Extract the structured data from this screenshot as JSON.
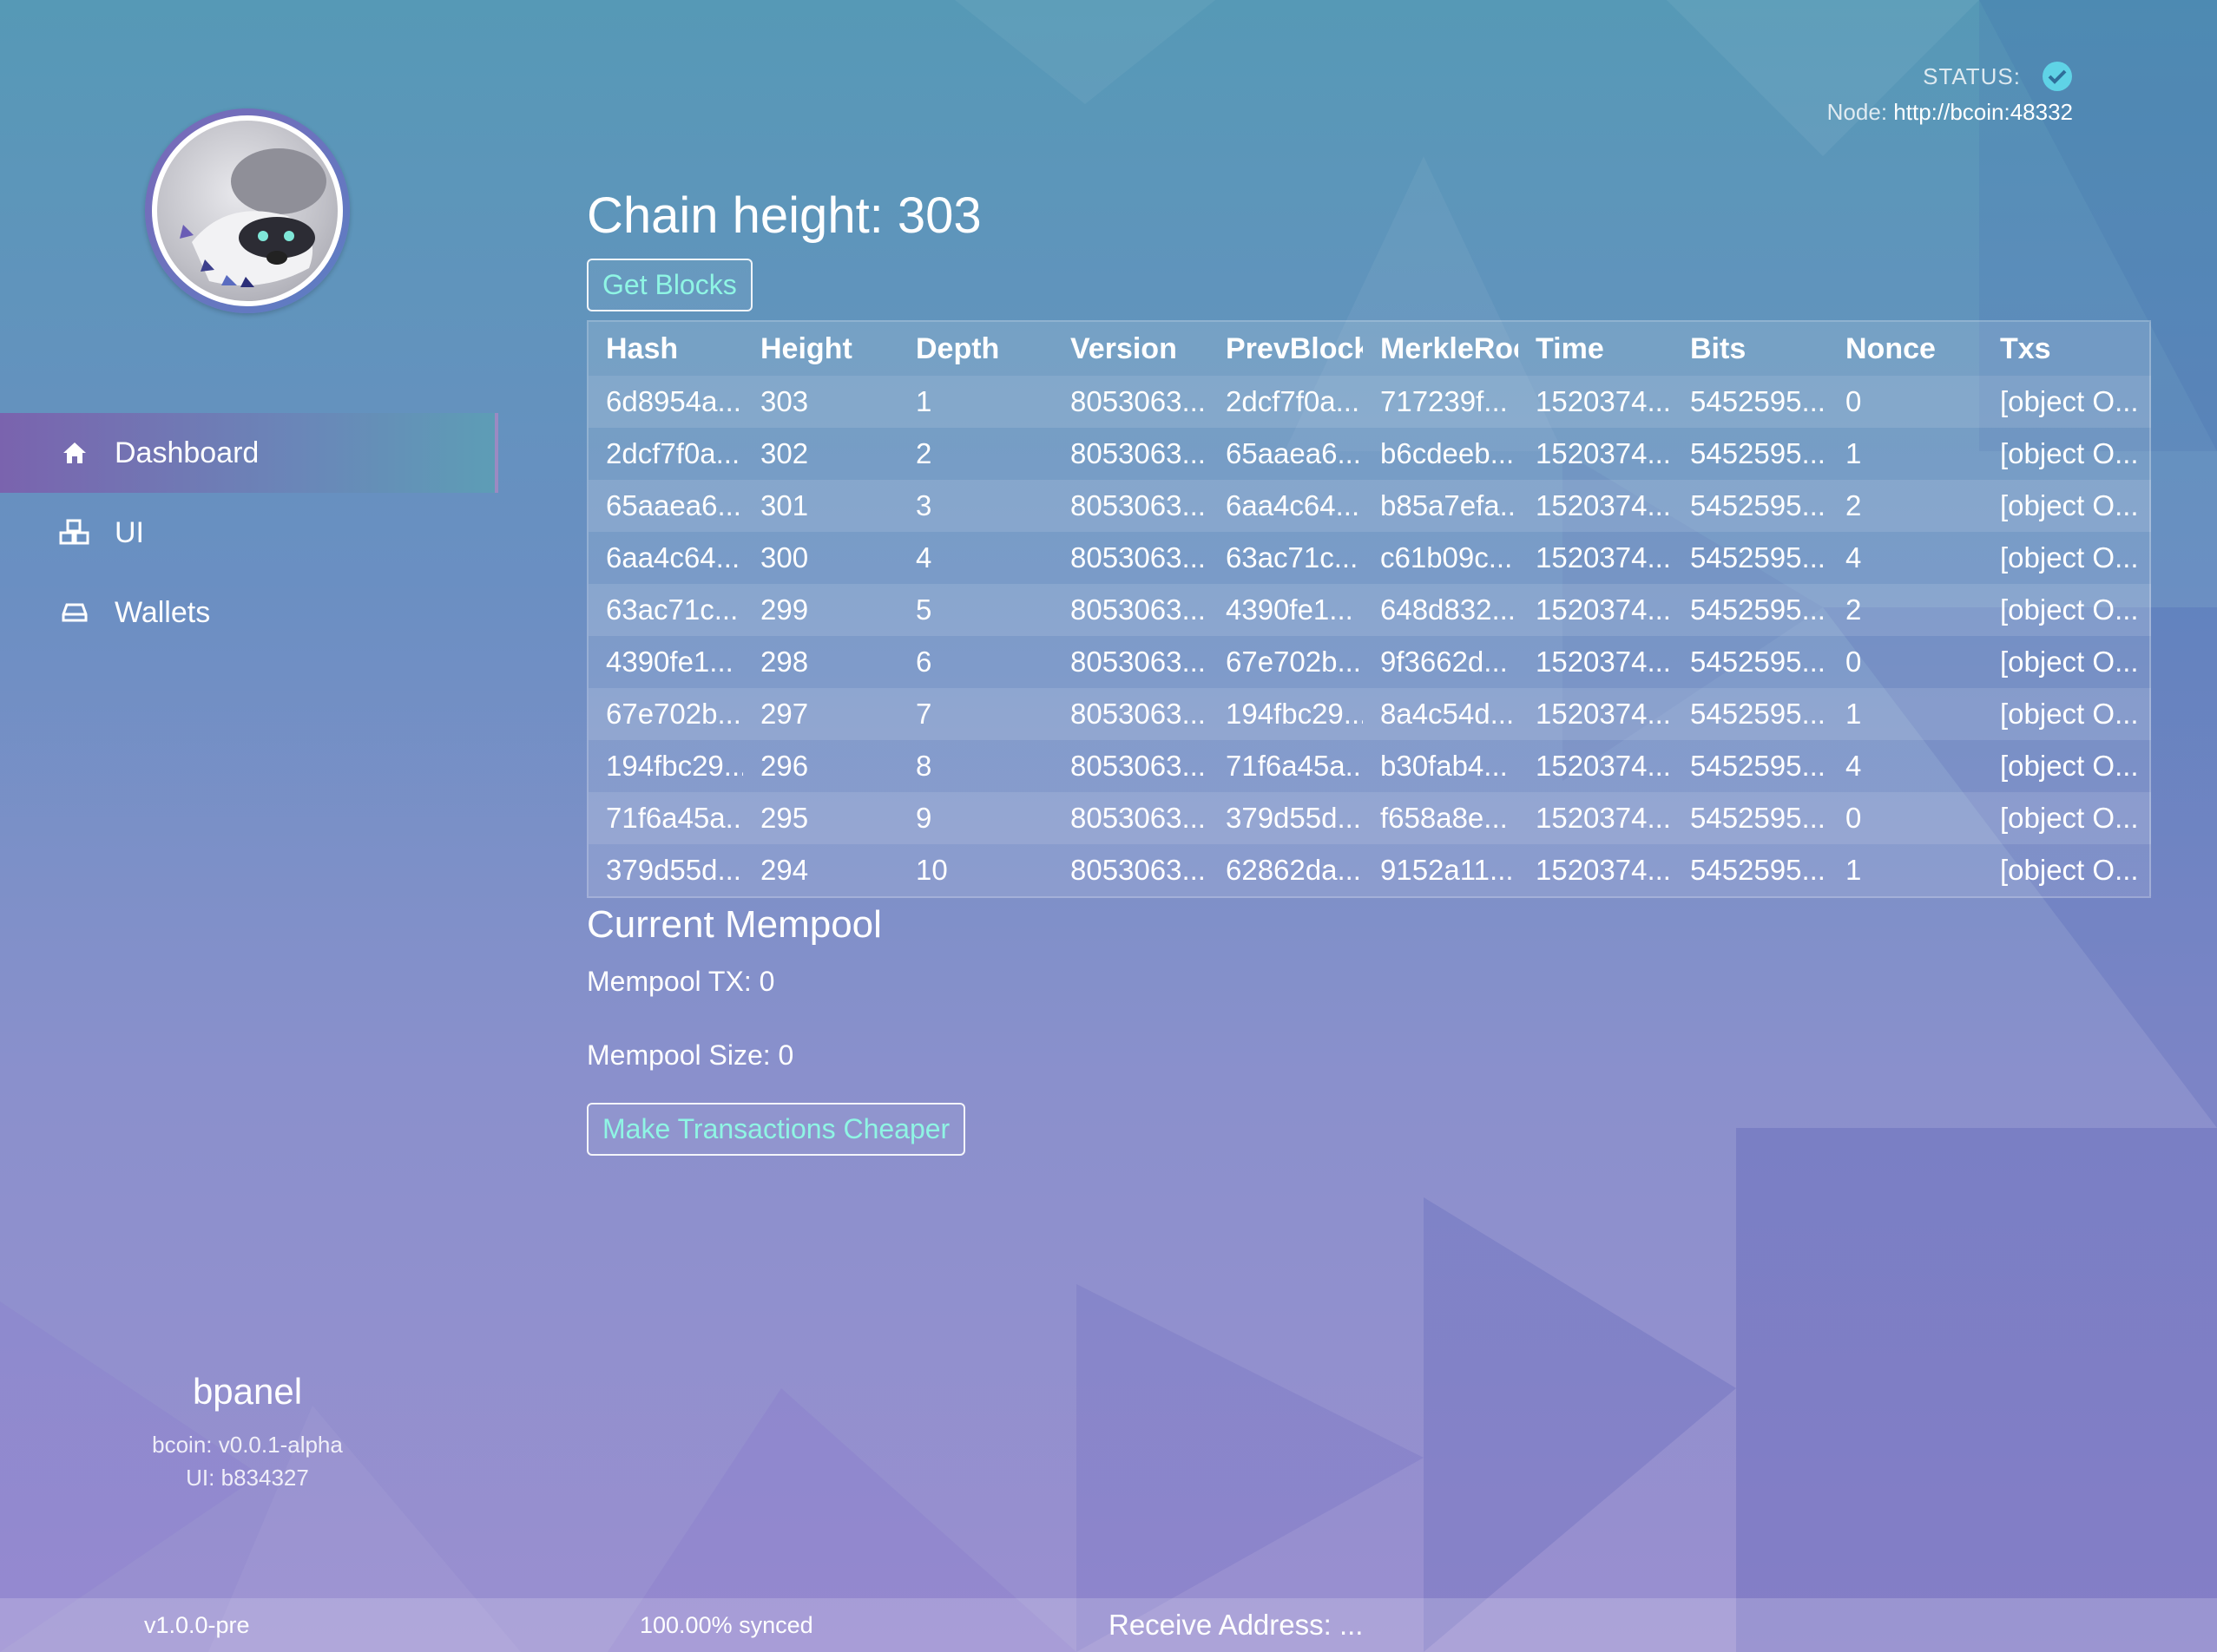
{
  "header": {
    "status_label": "STATUS:",
    "node_label": "Node:",
    "node_url": "http://bcoin:48332"
  },
  "sidebar": {
    "items": [
      {
        "label": "Dashboard",
        "icon": "home-icon",
        "active": true
      },
      {
        "label": "UI",
        "icon": "cubes-icon",
        "active": false
      },
      {
        "label": "Wallets",
        "icon": "hdd-icon",
        "active": false
      }
    ],
    "brand": {
      "title": "bpanel",
      "bcoin_version": "bcoin: v0.0.1-alpha",
      "ui_version": "UI: b834327"
    }
  },
  "main": {
    "chain_height": "Chain height: 303",
    "get_blocks_label": "Get Blocks",
    "table": {
      "columns": [
        "Hash",
        "Height",
        "Depth",
        "Version",
        "PrevBlock",
        "MerkleRoot",
        "Time",
        "Bits",
        "Nonce",
        "Txs"
      ],
      "rows": [
        [
          "6d8954a...",
          "303",
          "1",
          "8053063...",
          "2dcf7f0a...",
          "717239f...",
          "1520374...",
          "5452595...",
          "0",
          "[object O..."
        ],
        [
          "2dcf7f0a...",
          "302",
          "2",
          "8053063...",
          "65aaea6...",
          "b6cdeeb...",
          "1520374...",
          "5452595...",
          "1",
          "[object O..."
        ],
        [
          "65aaea6...",
          "301",
          "3",
          "8053063...",
          "6aa4c64...",
          "b85a7efa...",
          "1520374...",
          "5452595...",
          "2",
          "[object O..."
        ],
        [
          "6aa4c64...",
          "300",
          "4",
          "8053063...",
          "63ac71c...",
          "c61b09c...",
          "1520374...",
          "5452595...",
          "4",
          "[object O..."
        ],
        [
          "63ac71c...",
          "299",
          "5",
          "8053063...",
          "4390fe1...",
          "648d832...",
          "1520374...",
          "5452595...",
          "2",
          "[object O..."
        ],
        [
          "4390fe1...",
          "298",
          "6",
          "8053063...",
          "67e702b...",
          "9f3662d...",
          "1520374...",
          "5452595...",
          "0",
          "[object O..."
        ],
        [
          "67e702b...",
          "297",
          "7",
          "8053063...",
          "194fbc29...",
          "8a4c54d...",
          "1520374...",
          "5452595...",
          "1",
          "[object O..."
        ],
        [
          "194fbc29...",
          "296",
          "8",
          "8053063...",
          "71f6a45a...",
          "b30fab4...",
          "1520374...",
          "5452595...",
          "4",
          "[object O..."
        ],
        [
          "71f6a45a...",
          "295",
          "9",
          "8053063...",
          "379d55d...",
          "f658a8e...",
          "1520374...",
          "5452595...",
          "0",
          "[object O..."
        ],
        [
          "379d55d...",
          "294",
          "10",
          "8053063...",
          "62862da...",
          "9152a11...",
          "1520374...",
          "5452595...",
          "1",
          "[object O..."
        ]
      ]
    },
    "mempool": {
      "title": "Current Mempool",
      "tx": "Mempool TX: 0",
      "size": "Mempool Size: 0",
      "cheaper_label": "Make Transactions Cheaper"
    }
  },
  "footer": {
    "version": "v1.0.0-pre",
    "synced": "100.00% synced",
    "receive": "Receive Address: ..."
  },
  "colors": {
    "accent": "#8ff5e4",
    "status_ok": "#5fd3e6"
  }
}
